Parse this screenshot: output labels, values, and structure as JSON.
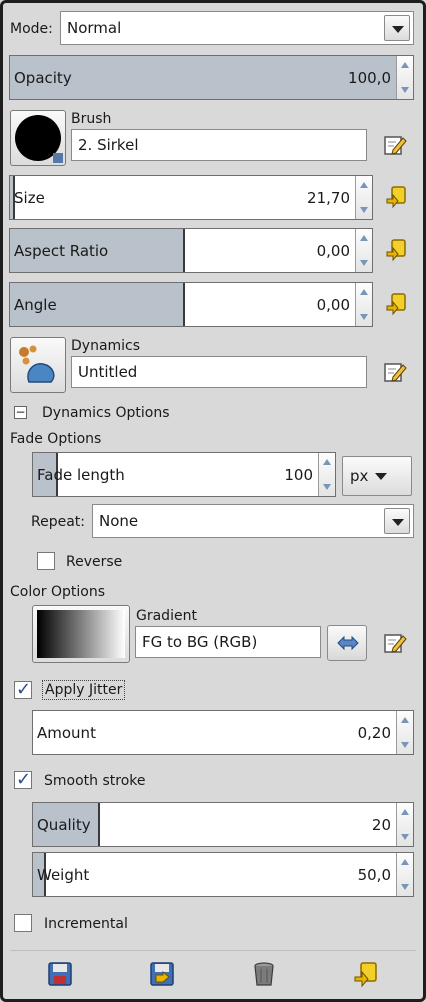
{
  "mode": {
    "label": "Mode:",
    "value": "Normal"
  },
  "opacity": {
    "label": "Opacity",
    "value": "100,0",
    "fraction": 1.0
  },
  "brush": {
    "label": "Brush",
    "name": "2. Sirkel"
  },
  "size": {
    "label": "Size",
    "value": "21,70",
    "fraction": 0.01
  },
  "aspect_ratio": {
    "label": "Aspect Ratio",
    "value": "0,00",
    "fraction": 0.5
  },
  "angle": {
    "label": "Angle",
    "value": "0,00",
    "fraction": 0.5
  },
  "dynamics": {
    "label": "Dynamics",
    "name": "Untitled"
  },
  "dynamics_options": {
    "label": "Dynamics Options",
    "expander": "−"
  },
  "fade_options": {
    "label": "Fade Options",
    "fade_length": {
      "label": "Fade length",
      "value": "100",
      "fraction": 0.08
    },
    "unit": "px",
    "repeat": {
      "label": "Repeat:",
      "value": "None"
    },
    "reverse": {
      "label": "Reverse",
      "checked": false
    }
  },
  "color_options": {
    "label": "Color Options",
    "gradient_label": "Gradient",
    "gradient_name": "FG to BG (RGB)"
  },
  "apply_jitter": {
    "label": "Apply Jitter",
    "checked": true
  },
  "amount": {
    "label": "Amount",
    "value": "0,20",
    "fraction": 0.0
  },
  "smooth_stroke": {
    "label": "Smooth stroke",
    "checked": true
  },
  "quality": {
    "label": "Quality",
    "value": "20",
    "fraction": 0.18
  },
  "weight": {
    "label": "Weight",
    "value": "50,0",
    "fraction": 0.03
  },
  "incremental": {
    "label": "Incremental",
    "checked": false
  },
  "checkmark": "✓",
  "footer_icons": [
    "save-options-icon",
    "restore-options-icon",
    "delete-options-icon",
    "reset-options-icon"
  ],
  "colors": {
    "slider_fill": "#b9c1ca",
    "arrow": "#7a95b8",
    "icon_yellow": "#e8b400"
  }
}
